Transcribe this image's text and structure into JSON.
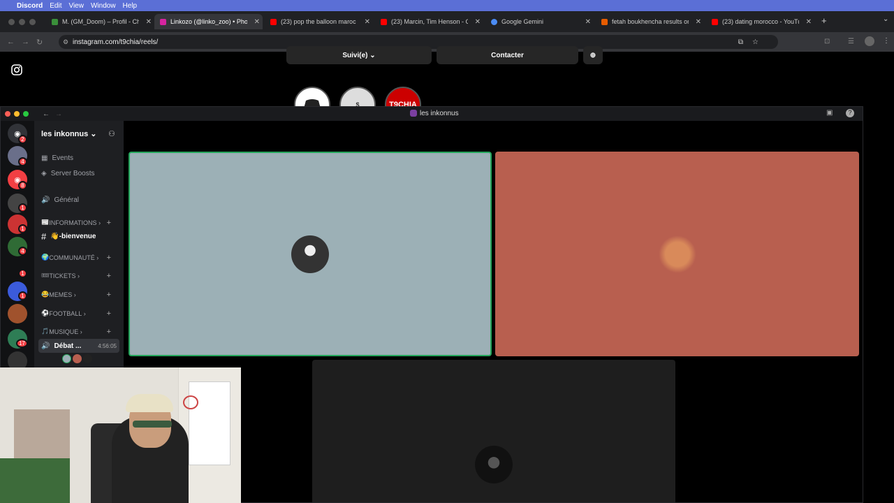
{
  "menubar": {
    "app": "Discord",
    "items": [
      "Edit",
      "View",
      "Window",
      "Help"
    ]
  },
  "tabs": [
    {
      "title": "M. (GM_Doom) – Profil - Che",
      "color": "#3a8f3a"
    },
    {
      "title": "Linkozo (@linko_zoo) • Photo",
      "color": "#d6249f",
      "active": true
    },
    {
      "title": "(23) pop the balloon maroc -",
      "color": "#ff0000"
    },
    {
      "title": "(23) Marcin, Tim Henson - Ch",
      "color": "#ff0000"
    },
    {
      "title": "Google Gemini",
      "color": "#4b8cf5"
    },
    {
      "title": "fetah boukhencha results on",
      "color": "#e65c00"
    },
    {
      "title": "(23) dating morocco - YouTub",
      "color": "#ff0000"
    }
  ],
  "address": {
    "url": "instagram.com/t9chia/reels/"
  },
  "instagram": {
    "follow_label": "Suivi(e)",
    "contact_label": "Contacter",
    "highlight_label": "T9CHIA"
  },
  "discord": {
    "window_title": "les inkonnus",
    "server_name": "les inkonnus",
    "events": "Events",
    "boosts": "Server Boosts",
    "general": "Général",
    "categories": [
      {
        "label": "INFORMATIONS",
        "emoji": "📰"
      },
      {
        "label": "COMMUNAUTÉ",
        "emoji": "🌍"
      },
      {
        "label": "TICKETS",
        "emoji": "🎟"
      },
      {
        "label": "MEMES",
        "emoji": "😂"
      },
      {
        "label": "FOOTBALL",
        "emoji": "⚽"
      },
      {
        "label": "MUSIQUE",
        "emoji": "🎵"
      }
    ],
    "welcome_channel": "👋-bienvenue",
    "voice_channel": "Débat ...",
    "voice_time": "4:56:05",
    "badges": [
      "2",
      "4",
      "8",
      "1",
      "1",
      "4",
      "1",
      "1",
      "17"
    ],
    "tiles": [
      {
        "color": "#9cb0b6",
        "speaking": true
      },
      {
        "color": "#b85f4f",
        "speaking": false
      },
      {
        "color": "#1e1e1e",
        "speaking": false
      }
    ]
  }
}
